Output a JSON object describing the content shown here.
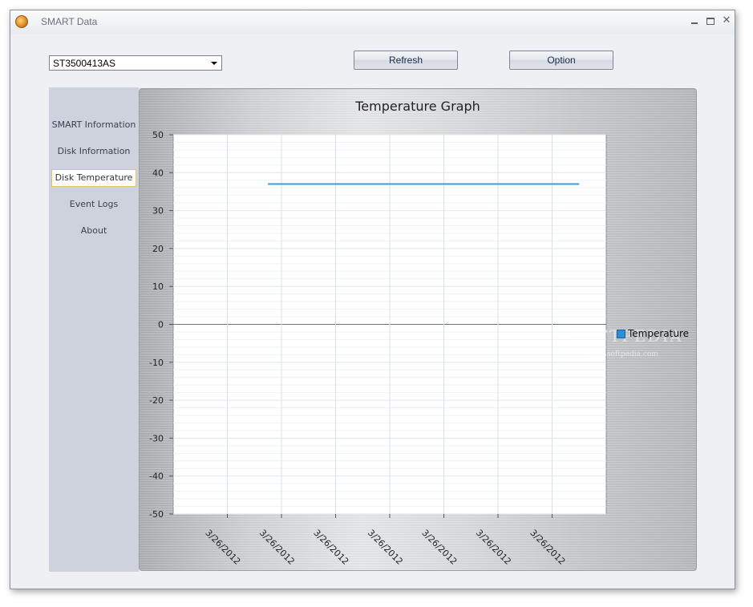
{
  "window": {
    "title": "SMART Data"
  },
  "toolbar": {
    "drive_select": "ST3500413AS",
    "refresh_label": "Refresh",
    "option_label": "Option"
  },
  "sidebar": {
    "items": [
      {
        "label": "SMART Information",
        "active": false
      },
      {
        "label": "Disk Information",
        "active": false
      },
      {
        "label": "Disk Temperature",
        "active": true
      },
      {
        "label": "Event Logs",
        "active": false
      },
      {
        "label": "About",
        "active": false
      }
    ]
  },
  "watermark": {
    "text": "SOFTPEDIA",
    "sub": "www.softpedia.com"
  },
  "chart_data": {
    "type": "line",
    "title": "Temperature Graph",
    "xlabel": "",
    "ylabel": "",
    "ylim": [
      -50,
      50
    ],
    "yticks": [
      50,
      40,
      30,
      20,
      10,
      0,
      -10,
      -20,
      -30,
      -40,
      -50
    ],
    "categories": [
      "3/26/2012",
      "3/26/2012",
      "3/26/2012",
      "3/26/2012",
      "3/26/2012",
      "3/26/2012",
      "3/26/2012"
    ],
    "series": [
      {
        "name": "Temperature",
        "color": "#3a9bd8",
        "x_start_index": 1.75,
        "x_end_index": 8.5,
        "values": [
          37,
          37
        ]
      }
    ],
    "legend": "right",
    "grid": true
  }
}
